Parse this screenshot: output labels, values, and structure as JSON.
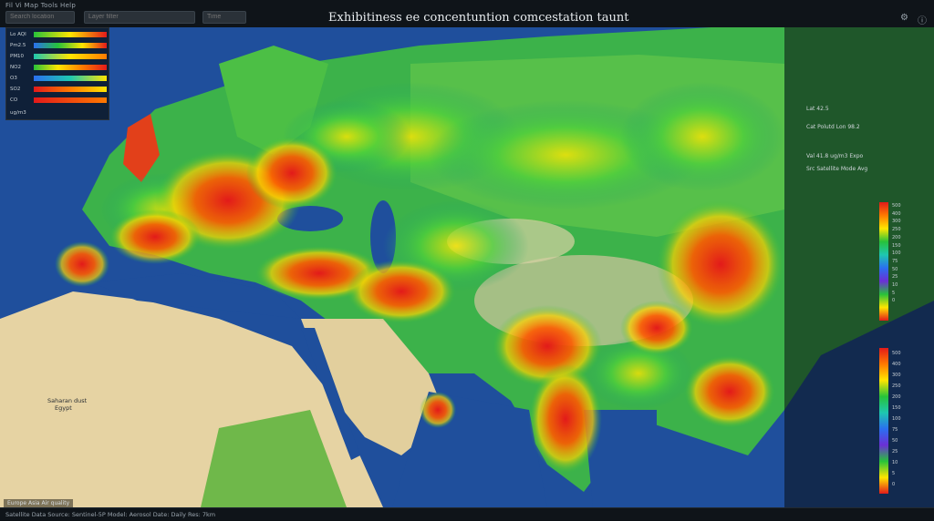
{
  "toolbar": {
    "menu_text": "Fil   Vi   Map   Tools   Help",
    "search_left_placeholder": "Search location",
    "search_mid_placeholder": "Layer filter",
    "search_right_placeholder": "Time"
  },
  "map": {
    "title": "Exhibitiness ee concentuntion comcestation taunt",
    "region_label_africa": "Saharan dust",
    "region_label_egypt": "Egypt"
  },
  "legend_left": {
    "rows": [
      {
        "label": "Lo AQI"
      },
      {
        "label": "Pm2.5"
      },
      {
        "label": "PM10"
      },
      {
        "label": "NO2"
      },
      {
        "label": "O3"
      },
      {
        "label": "SO2"
      },
      {
        "label": "CO"
      }
    ],
    "footer": "ug/m3"
  },
  "side_panel": {
    "info_lines": [
      "Lat 42.5",
      "Cat  Polutd  Lon 98.2",
      "Val  41.8  ug/m3  Expo",
      "Src  Satellite  Mode  Avg"
    ],
    "scale_top_labels": [
      "500",
      "400",
      "300",
      "250",
      "200",
      "150",
      "100",
      "75",
      "50",
      "25",
      "10",
      "5",
      "0"
    ],
    "scale_bottom_labels": [
      "500",
      "400",
      "300",
      "250",
      "200",
      "150",
      "100",
      "75",
      "50",
      "25",
      "10",
      "5",
      "0"
    ]
  },
  "status": {
    "text": "Satellite  Data  Source: Sentinel-5P  Model: Aerosol  Date: Daily  Res: 7km",
    "caption": "Europe  Asia  Air quality"
  },
  "colors": {
    "high": "#e21a1a",
    "mid_high": "#ff7a00",
    "mid": "#ffe600",
    "low": "#27c23a",
    "water": "#1f4f9c",
    "desert": "#e6d3a3"
  }
}
